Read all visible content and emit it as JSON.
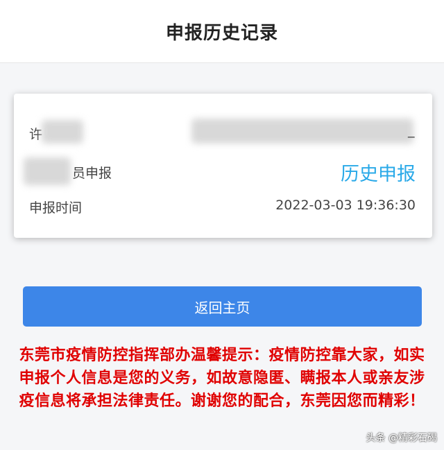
{
  "header": {
    "title": "申报历史记录"
  },
  "record": {
    "name_partial": "许",
    "name_trailing": "_",
    "type_label": "员申报",
    "history_link": "历史申报",
    "time_label": "申报时间",
    "time_value": "2022-03-03 19:36:30"
  },
  "button": {
    "label": "返回主页"
  },
  "notice": {
    "text": "东莞市疫情防控指挥部办温馨提示：疫情防控靠大家，如实申报个人信息是您的义务，如故意隐匿、瞒报本人或亲友涉疫信息将承担法律责任。谢谢您的配合，东莞因您而精彩！"
  },
  "watermark": {
    "text": "头条 @精彩石碣"
  },
  "colors": {
    "link": "#29a9e8",
    "button": "#3d86e8",
    "notice": "#e00000"
  }
}
